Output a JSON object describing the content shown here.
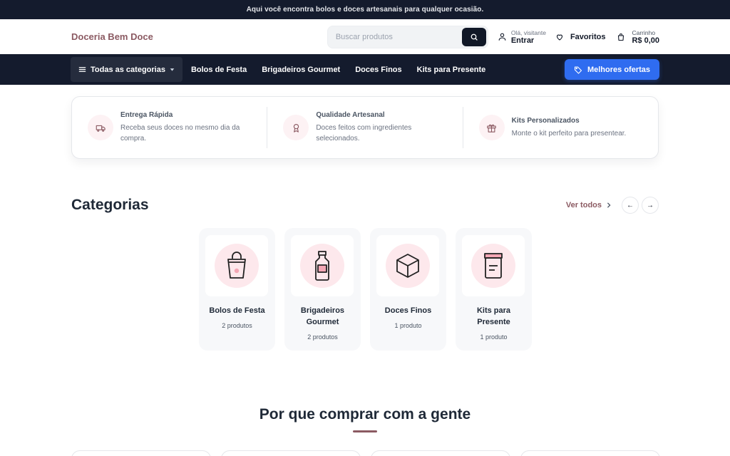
{
  "topbar": {
    "message": "Aqui você encontra bolos e doces artesanais para qualquer ocasião."
  },
  "header": {
    "logo": "Doceria Bem Doce",
    "search_placeholder": "Buscar produtos",
    "account_greeting": "Olá, visitante",
    "account_action": "Entrar",
    "favorites_label": "Favoritos",
    "cart_label": "Carrinho",
    "cart_total": "R$ 0,00"
  },
  "nav": {
    "all_categories": "Todas as categorias",
    "links": [
      "Bolos de Festa",
      "Brigadeiros Gourmet",
      "Doces Finos",
      "Kits para Presente"
    ],
    "offers_label": "Melhores ofertas"
  },
  "features": [
    {
      "title": "Entrega Rápida",
      "desc": "Receba seus doces no mesmo dia da compra.",
      "icon": "truck-icon"
    },
    {
      "title": "Qualidade Artesanal",
      "desc": "Doces feitos com ingredientes selecionados.",
      "icon": "award-icon"
    },
    {
      "title": "Kits Personalizados",
      "desc": "Monte o kit perfeito para presentear.",
      "icon": "gift-icon"
    }
  ],
  "categories": {
    "title": "Categorias",
    "see_all": "Ver todos",
    "prev": "←",
    "next": "→",
    "items": [
      {
        "name": "Bolos de Festa",
        "count": "2 produtos",
        "icon": "bag-icon"
      },
      {
        "name": "Brigadeiros Gourmet",
        "count": "2 produtos",
        "icon": "bottle-icon"
      },
      {
        "name": "Doces Finos",
        "count": "1 produto",
        "icon": "box-icon"
      },
      {
        "name": "Kits para Presente",
        "count": "1 produto",
        "icon": "jar-icon"
      }
    ]
  },
  "why": {
    "title": "Por que comprar com a gente"
  },
  "colors": {
    "brand": "#8b5a62",
    "dark": "#141b2d",
    "accent": "#2f6cf0",
    "pink": "#fde8ec"
  }
}
